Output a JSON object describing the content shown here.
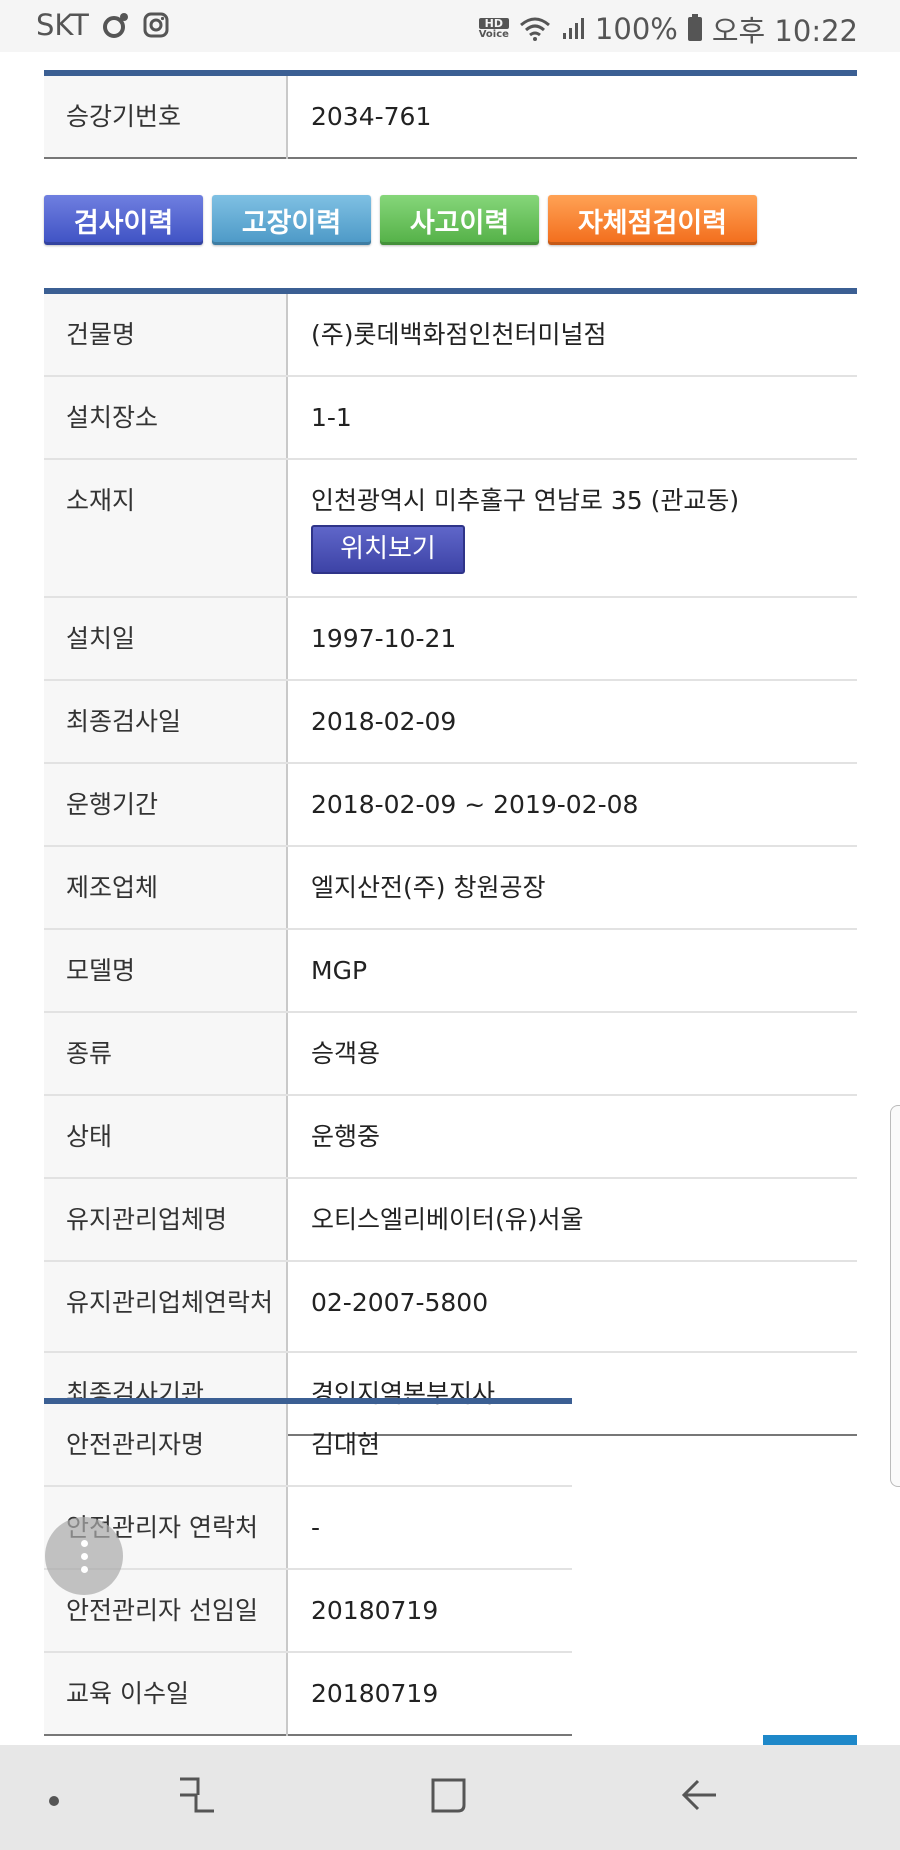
{
  "status_bar": {
    "carrier": "SKT",
    "hd_line1": "HD",
    "hd_line2": "Voice",
    "battery": "100%",
    "time": "오후 10:22"
  },
  "top_table": {
    "rows": [
      {
        "label": "승강기번호",
        "value": "2034-761"
      }
    ]
  },
  "history_buttons": {
    "inspection": "검사이력",
    "failure": "고장이력",
    "accident": "사고이력",
    "self_check": "자체점검이력"
  },
  "main_table": {
    "building_label": "건물명",
    "building_value": "(주)롯데백화점인천터미널점",
    "install_place_label": "설치장소",
    "install_place_value": "1-1",
    "address_label": "소재지",
    "address_value": "인천광역시 미추홀구 연남로 35 (관교동)",
    "location_button": "위치보기",
    "install_date_label": "설치일",
    "install_date_value": "1997-10-21",
    "last_inspection_label": "최종검사일",
    "last_inspection_value": "2018-02-09",
    "operation_period_label": "운행기간",
    "operation_period_value": "2018-02-09 ~ 2019-02-08",
    "manufacturer_label": "제조업체",
    "manufacturer_value": "엘지산전(주) 창원공장",
    "model_label": "모델명",
    "model_value": "MGP",
    "type_label": "종류",
    "type_value": "승객용",
    "state_label": "상태",
    "state_value": "운행중",
    "maintenance_company_label": "유지관리업체명",
    "maintenance_company_value": "오티스엘리베이터(유)서울",
    "maintenance_contact_label": "유지관리업체연락처",
    "maintenance_contact_value": "02-2007-5800",
    "inspection_agency_label": "최종검사기관",
    "inspection_agency_value": "경인지역본부지사"
  },
  "safety_table": {
    "manager_name_label": "안전관리자명",
    "manager_name_value": "김대현",
    "manager_contact_label": "안전관리자 연락처",
    "manager_contact_value": "-",
    "appointment_label": "안전관리자 선임일",
    "appointment_value": "20180719",
    "education_label": "교육 이수일",
    "education_value": "20180719"
  },
  "colors": {
    "table_top_border": "#3b5f93",
    "btn_inspection": "#4a5bd0",
    "btn_failure": "#5ba6d2",
    "btn_accident": "#62bd55",
    "btn_self_check": "#f57f2c",
    "location_button": "#4a50b5"
  }
}
